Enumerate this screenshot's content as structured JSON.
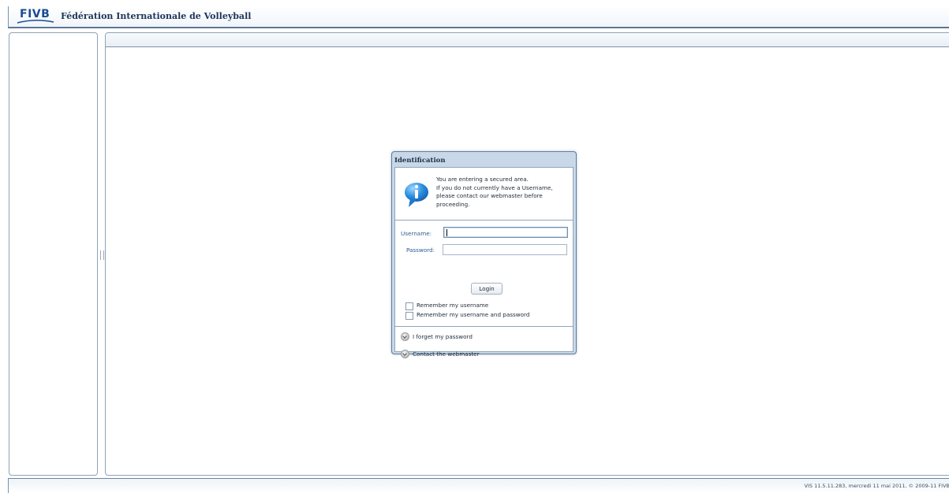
{
  "header": {
    "logo_text": "FIVB",
    "organization": "Fédération Internationale de Volleyball"
  },
  "dialog": {
    "title": "Identification",
    "info_lines": [
      "You are entering a secured area.",
      "If you do not currently have a Username,",
      "please contact our webmaster before",
      "proceeding."
    ],
    "username_label": "Username:",
    "username_value": "",
    "password_label": "Password:",
    "password_value": "",
    "login_button": "Login",
    "remember_username": "Remember my username",
    "remember_username_password": "Remember my username and password",
    "forgot_password_link": "I forget my password",
    "contact_webmaster_link": "Contact the webmaster"
  },
  "footer": {
    "version_text": "VIS 11.5.11.283, mercredi 11 mai 2011, © 2009-11 FIVB"
  },
  "colors": {
    "brand_blue": "#1a4b93",
    "dialog_frame": "#c9d8e8",
    "label_blue": "#2a5d96"
  },
  "icons": [
    "info-icon",
    "chevron-down-icon"
  ]
}
